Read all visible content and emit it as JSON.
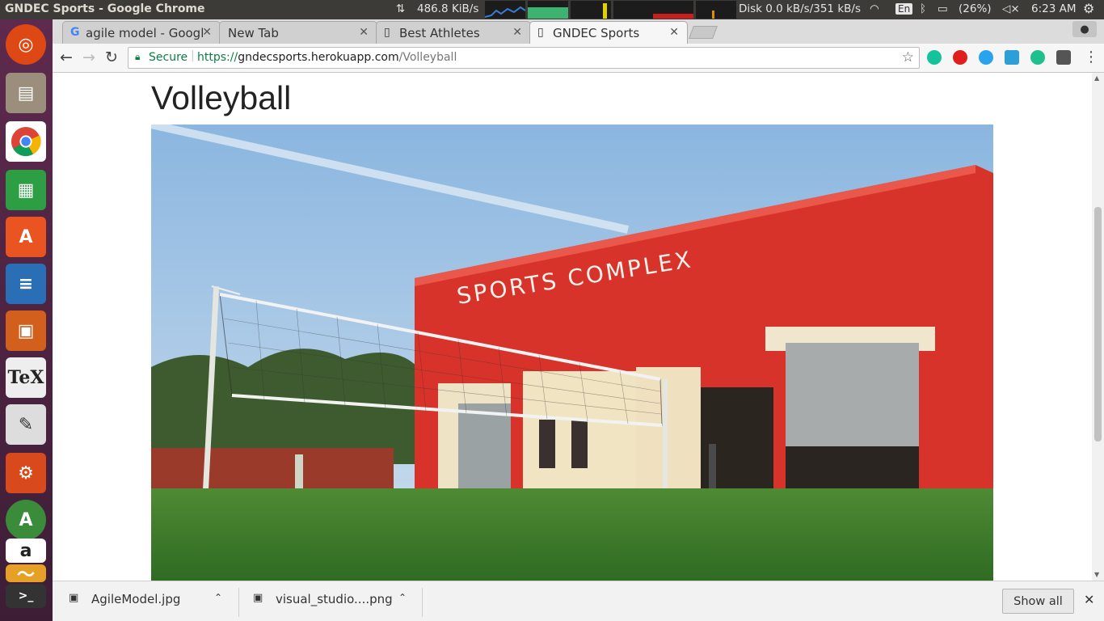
{
  "window_title": "GNDEC Sports - Google Chrome",
  "indicators": {
    "net_speed": "486.8 KiB/s",
    "disk": "Disk 0.0 kB/s/351 kB/s",
    "keyboard": "En",
    "battery": "(26%)",
    "time": "6:23 AM"
  },
  "tabs": [
    {
      "label": "agile model - Googl",
      "icon": "google-g-icon",
      "active": false
    },
    {
      "label": "New Tab",
      "icon": "",
      "active": false
    },
    {
      "label": "Best Athletes",
      "icon": "page-icon",
      "active": false
    },
    {
      "label": "GNDEC Sports",
      "icon": "page-icon",
      "active": true
    }
  ],
  "address": {
    "secure_label": "Secure",
    "url_prefix": "https://",
    "url_host": "gndecsports.herokuapp.com",
    "url_path": "/Volleyball"
  },
  "page": {
    "heading": "Volleyball",
    "photo_sign": "SPORTS COMPLEX"
  },
  "downloads": [
    {
      "name": "AgileModel.jpg"
    },
    {
      "name": "visual_studio....png"
    }
  ],
  "show_all_label": "Show all",
  "launcher": [
    "ubuntu-dash-icon",
    "files-icon",
    "chrome-icon",
    "calc-spreadsheet-icon",
    "software-center-icon",
    "writer-document-icon",
    "impress-presentation-icon",
    "tex-editor-icon",
    "text-editor-icon",
    "system-settings-icon",
    "android-studio-icon",
    "amazon-icon",
    "system-monitor-icon",
    "terminal-icon"
  ],
  "colors": {
    "secure_green": "#0b8043",
    "launcher_bg": "#5e2a4e",
    "topbar_bg": "#3c3b37"
  }
}
